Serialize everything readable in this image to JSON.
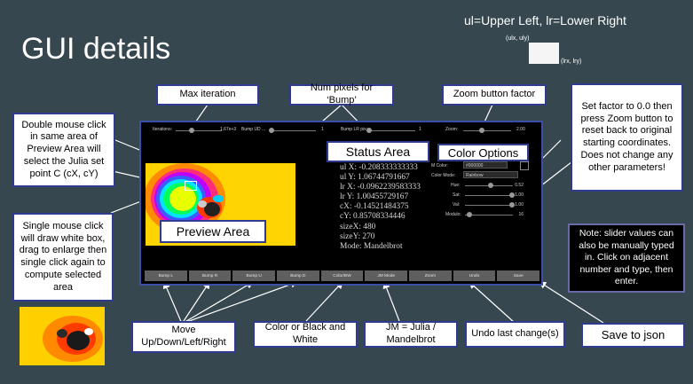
{
  "title": "GUI details",
  "legend": {
    "text": "ul=Upper Left, lr=Lower Right",
    "ul_coord": "(ulx, uly)",
    "lr_coord": "(lrx, lry)"
  },
  "callouts": {
    "max_iteration": "Max iteration",
    "num_pixels": "Num pixels for ‘Bump’",
    "zoom_factor": "Zoom button factor",
    "double_click": "Double mouse click in same area of Preview Area will select the Julia set point C (cX, cY)",
    "single_click": "Single mouse click will draw white box, drag to enlarge then single click again to compute selected area",
    "reset": "Set factor to 0.0 then press Zoom button to reset back to original starting coordinates.  Does not change any other parameters!",
    "slider_note": "Note: slider values can also be manually typed in. Click on adjacent number and type, then enter.",
    "move": "Move Up/Down/Left/Right",
    "color_bw": "Color or Black and White",
    "jm": "JM = Julia / Mandelbrot",
    "undo": "Undo last change(s)",
    "save": "Save to json"
  },
  "app": {
    "topbar": {
      "iterations_label": "Iterations:",
      "iterations_value": "1.67e+3",
      "bump_ud_label": "Bump UD ...",
      "bump_ud_value": "1",
      "bump_lr_label": "Bump LR pix:",
      "bump_lr_value": "1",
      "zoom_label": "Zoom:",
      "zoom_value": "2.00"
    },
    "status_label": "Status Area",
    "options_label": "Color Options",
    "preview_label": "Preview Area",
    "status": [
      "ul X: -0.208333333333",
      "ul Y: 1.06744791667",
      "lr X: -0.0962239583333",
      "lr Y: 1.00455729167",
      "cX: -0.14521484375",
      "cY: 0.85708334446",
      "sizeX: 480",
      "sizeY: 270",
      "Mode: Mandelbrot"
    ],
    "options": {
      "mcolor_label": "M Color:",
      "mcolor_value": "#000000",
      "mode_label": "Color Mode:",
      "mode_value": "Rainbow",
      "hue_label": "Hue:",
      "hue_value": "0.52",
      "sat_label": "Sat:",
      "sat_value": "1.00",
      "val_label": "Val:",
      "val_value": "1.00",
      "modulo_label": "Modulo:",
      "modulo_value": "16"
    },
    "buttons": [
      "Bump L",
      "Bump R",
      "Bump U",
      "Bump D",
      "Color/BW",
      "JM Mode",
      "Zoom",
      "Undo",
      "Save"
    ]
  }
}
